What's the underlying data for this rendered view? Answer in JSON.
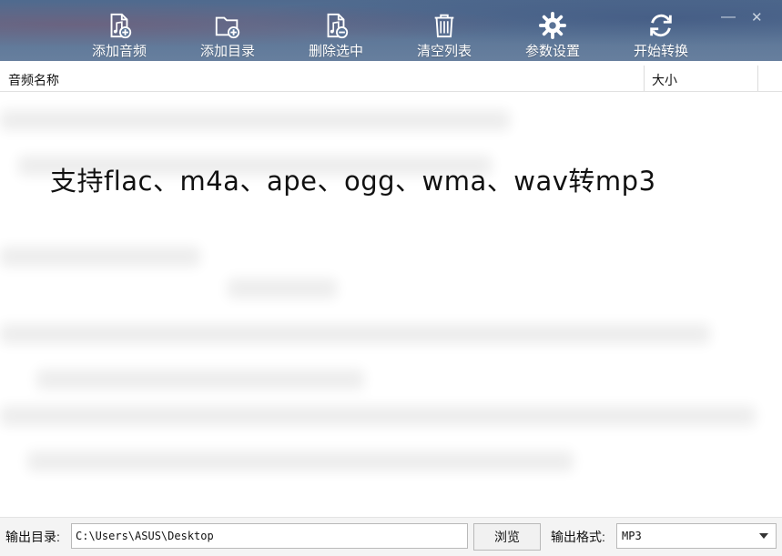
{
  "toolbar": {
    "buttons": [
      {
        "label": "添加音频",
        "icon": "add-audio-icon"
      },
      {
        "label": "添加目录",
        "icon": "add-folder-icon"
      },
      {
        "label": "删除选中",
        "icon": "delete-selected-icon"
      },
      {
        "label": "清空列表",
        "icon": "trash-icon"
      },
      {
        "label": "参数设置",
        "icon": "gear-icon"
      },
      {
        "label": "开始转换",
        "icon": "refresh-icon"
      }
    ],
    "minimize": "—",
    "close": "✕"
  },
  "list": {
    "columns": {
      "name": "音频名称",
      "size": "大小"
    },
    "promo_text": "支持flac、m4a、ape、ogg、wma、wav转mp3"
  },
  "bottom": {
    "output_dir_label": "输出目录:",
    "output_dir_value": "C:\\Users\\ASUS\\Desktop",
    "browse_label": "浏览",
    "format_label": "输出格式:",
    "format_value": "MP3"
  },
  "colors": {
    "toolbar": "#5a7396",
    "text": "#111111",
    "border": "#b9b9b9"
  }
}
